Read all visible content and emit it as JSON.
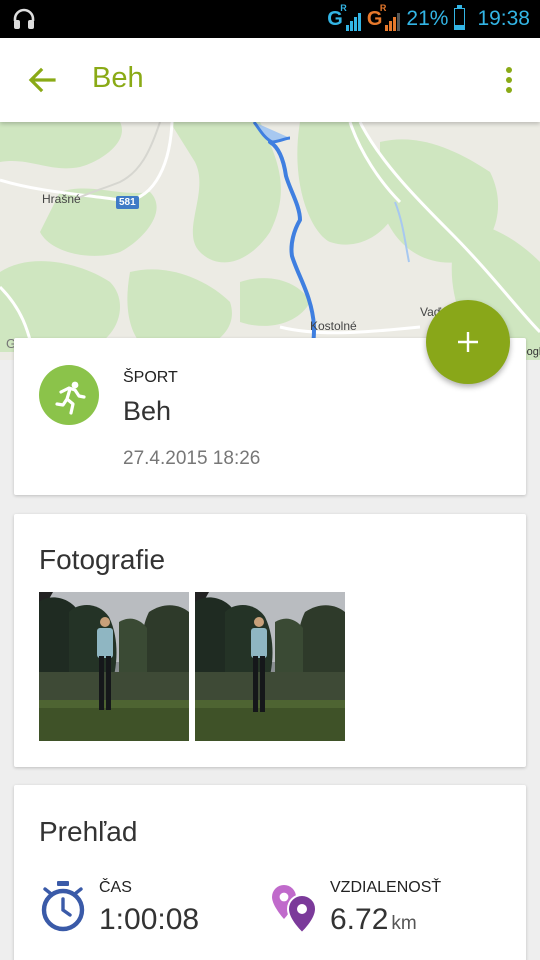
{
  "status_bar": {
    "network_1": "G",
    "network_1_sup": "R",
    "network_2": "G",
    "network_2_sup": "R",
    "battery_percent": "21%",
    "battery_level": 0.21,
    "time": "19:38",
    "colors": {
      "accent": "#33b5e5",
      "signal_2": "#e8792c"
    }
  },
  "app_bar": {
    "title": "Beh",
    "accent_color": "#8aaa16",
    "back_icon": "arrow-back-icon",
    "menu_icon": "more-vert-icon"
  },
  "map": {
    "labels": {
      "town_1": "Hrašné",
      "road_shield": "581",
      "town_2": "Kostolné",
      "town_3": "Vaďovce",
      "attribution_left": "Google",
      "attribution_right": "Google"
    },
    "route_color": "#3f7fe0"
  },
  "fab": {
    "icon": "plus-icon",
    "color": "#89a719"
  },
  "sport_card": {
    "category_label": "ŠPORT",
    "sport_name": "Beh",
    "datetime": "27.4.2015 18:26",
    "icon": "running-person-icon",
    "icon_bg": "#8bc34a"
  },
  "photos_card": {
    "title": "Fotografie",
    "photos": [
      {
        "name": "photo-1"
      },
      {
        "name": "photo-2"
      }
    ]
  },
  "overview_card": {
    "title": "Prehľad",
    "time": {
      "label": "ČAS",
      "value": "1:00:08",
      "icon": "stopwatch-icon",
      "icon_color": "#3a5aa8"
    },
    "distance": {
      "label": "VZDIALENOSŤ",
      "value": "6.72",
      "unit": "km",
      "icon": "map-pins-icon",
      "icon_color": "#7b3a9a"
    }
  }
}
